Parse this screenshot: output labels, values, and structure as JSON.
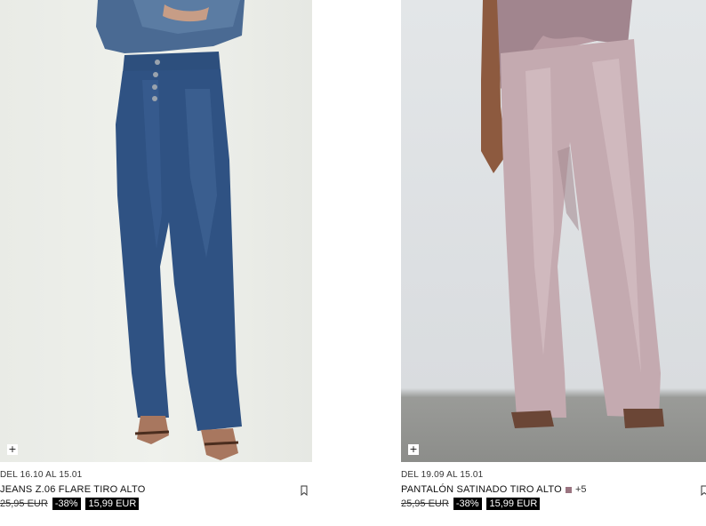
{
  "products": [
    {
      "dates": "DEL 16.10 AL 15.01",
      "name": "JEANS Z.06 FLARE TIRO ALTO",
      "old_price": "25,95 EUR",
      "discount": "-38%",
      "new_price": "15,99 EUR",
      "add_symbol": "+",
      "image": "flare-jeans-photo"
    },
    {
      "dates": "DEL 19.09 AL 15.01",
      "name": "PANTALÓN SATINADO TIRO ALTO",
      "colors_more": "+5",
      "swatch_color": "#9a7480",
      "old_price": "25,95 EUR",
      "discount": "-38%",
      "new_price": "15,99 EUR",
      "add_symbol": "+",
      "image": "satin-trousers-photo"
    }
  ]
}
